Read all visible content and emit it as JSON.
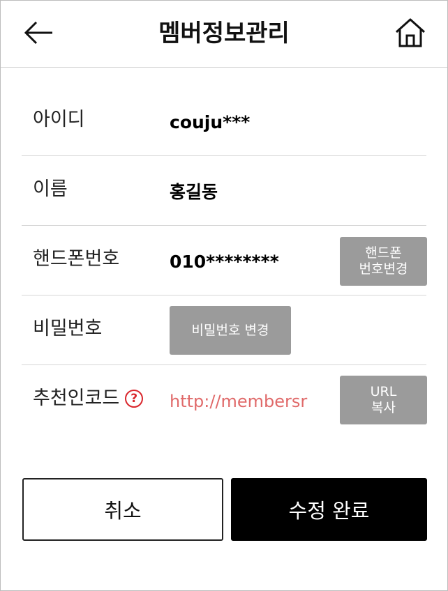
{
  "header": {
    "title": "멤버정보관리",
    "back_icon": "arrow-left-icon",
    "home_icon": "home-icon"
  },
  "fields": {
    "id": {
      "label": "아이디",
      "value": "couju***"
    },
    "name": {
      "label": "이름",
      "value": "홍길동"
    },
    "phone": {
      "label": "핸드폰번호",
      "value": "010********",
      "button_line1": "핸드폰",
      "button_line2": "번호변경"
    },
    "password": {
      "label": "비밀번호",
      "button": "비밀번호 변경"
    },
    "referral": {
      "label": "추천인코드",
      "help_glyph": "?",
      "value": "http://membersr",
      "button_line1": "URL",
      "button_line2": "복사"
    }
  },
  "actions": {
    "cancel": "취소",
    "submit": "수정 완료"
  },
  "colors": {
    "accent_button": "#000000",
    "gray_button": "#9b9b9b",
    "link": "#e06a6a",
    "help_icon": "#d9262c"
  }
}
